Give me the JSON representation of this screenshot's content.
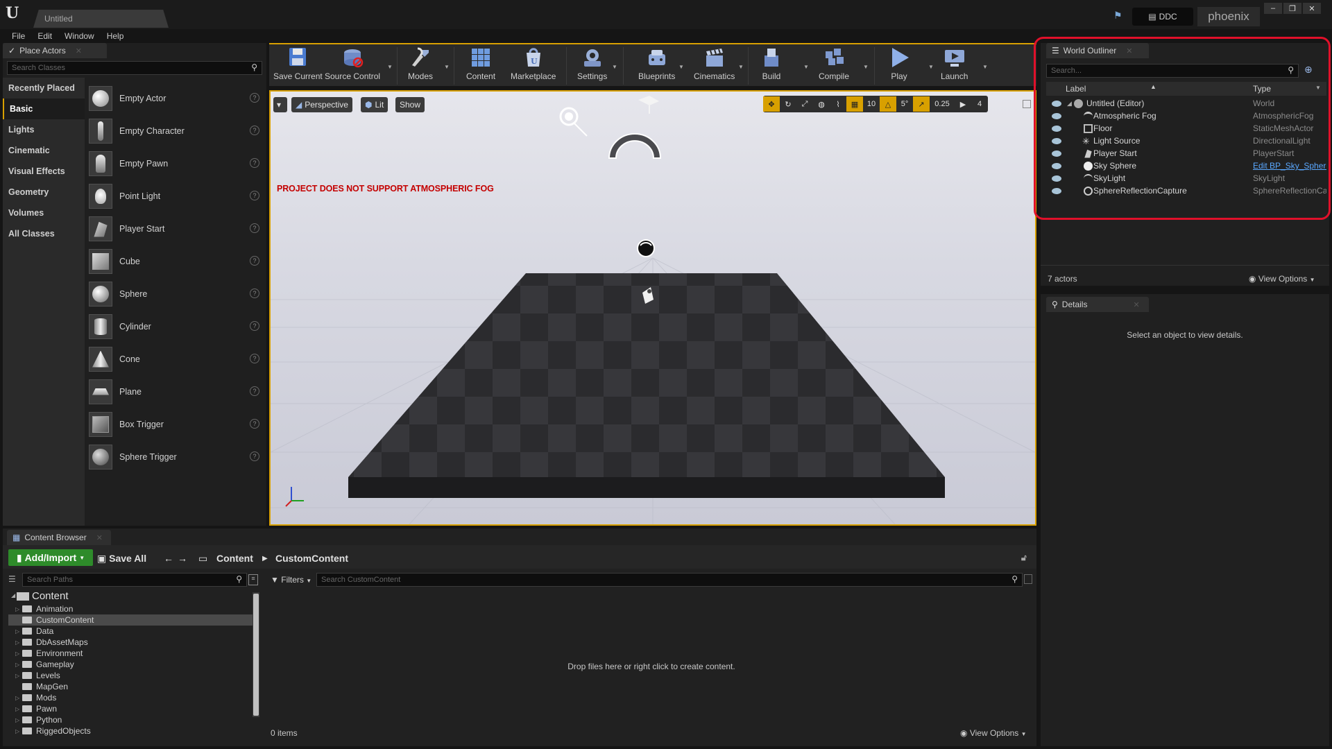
{
  "window": {
    "tab_title": "Untitled",
    "ddc_label": "DDC",
    "project_name": "phoenix",
    "controls": [
      "–",
      "❐",
      "✕"
    ]
  },
  "menu": [
    "File",
    "Edit",
    "Window",
    "Help"
  ],
  "place_actors": {
    "tab_label": "Place Actors",
    "search_placeholder": "Search Classes",
    "categories": [
      "Recently Placed",
      "Basic",
      "Lights",
      "Cinematic",
      "Visual Effects",
      "Geometry",
      "Volumes",
      "All Classes"
    ],
    "active_category": "Basic",
    "items": [
      "Empty Actor",
      "Empty Character",
      "Empty Pawn",
      "Point Light",
      "Player Start",
      "Cube",
      "Sphere",
      "Cylinder",
      "Cone",
      "Plane",
      "Box Trigger",
      "Sphere Trigger"
    ]
  },
  "toolbar": {
    "buttons": [
      "Save Current",
      "Source Control",
      "Modes",
      "Content",
      "Marketplace",
      "Settings",
      "Blueprints",
      "Cinematics",
      "Build",
      "Compile",
      "Play",
      "Launch"
    ]
  },
  "viewport": {
    "perspective_label": "Perspective",
    "lit_label": "Lit",
    "show_label": "Show",
    "grid_snap": "10",
    "rot_snap": "5°",
    "scale_snap": "0.25",
    "camera_speed": "4",
    "warning": "PROJECT DOES NOT SUPPORT ATMOSPHERIC FOG"
  },
  "outliner": {
    "tab_label": "World Outliner",
    "search_placeholder": "Search...",
    "col_label": "Label",
    "col_type": "Type",
    "root": {
      "label": "Untitled (Editor)",
      "type": "World"
    },
    "rows": [
      {
        "label": "Atmospheric Fog",
        "type": "AtmosphericFog"
      },
      {
        "label": "Floor",
        "type": "StaticMeshActor"
      },
      {
        "label": "Light Source",
        "type": "DirectionalLight"
      },
      {
        "label": "Player Start",
        "type": "PlayerStart"
      },
      {
        "label": "Sky Sphere",
        "type": "Edit BP_Sky_Sphere"
      },
      {
        "label": "SkyLight",
        "type": "SkyLight"
      },
      {
        "label": "SphereReflectionCapture",
        "type": "SphereReflectionCapture"
      }
    ],
    "actor_count": "7 actors",
    "view_options": "View Options"
  },
  "details": {
    "tab_label": "Details",
    "empty_message": "Select an object to view details."
  },
  "content_browser": {
    "tab_label": "Content Browser",
    "add_import": "Add/Import",
    "save_all": "Save All",
    "path": [
      "Content",
      "CustomContent"
    ],
    "search_paths_placeholder": "Search Paths",
    "filters_label": "Filters",
    "search_content_placeholder": "Search CustomContent",
    "root_folder": "Content",
    "folders": [
      "Animation",
      "CustomContent",
      "Data",
      "DbAssetMaps",
      "Environment",
      "Gameplay",
      "Levels",
      "MapGen",
      "Mods",
      "Pawn",
      "Python",
      "RiggedObjects"
    ],
    "selected_folder": "CustomContent",
    "drop_message": "Drop files here or right click to create content.",
    "item_count": "0 items",
    "view_options": "View Options"
  },
  "colors": {
    "accent": "#d8a000",
    "highlight_box": "#e0102a",
    "add_button": "#2e8b2a",
    "warning_text": "#c40000",
    "link": "#5aa8ff"
  }
}
